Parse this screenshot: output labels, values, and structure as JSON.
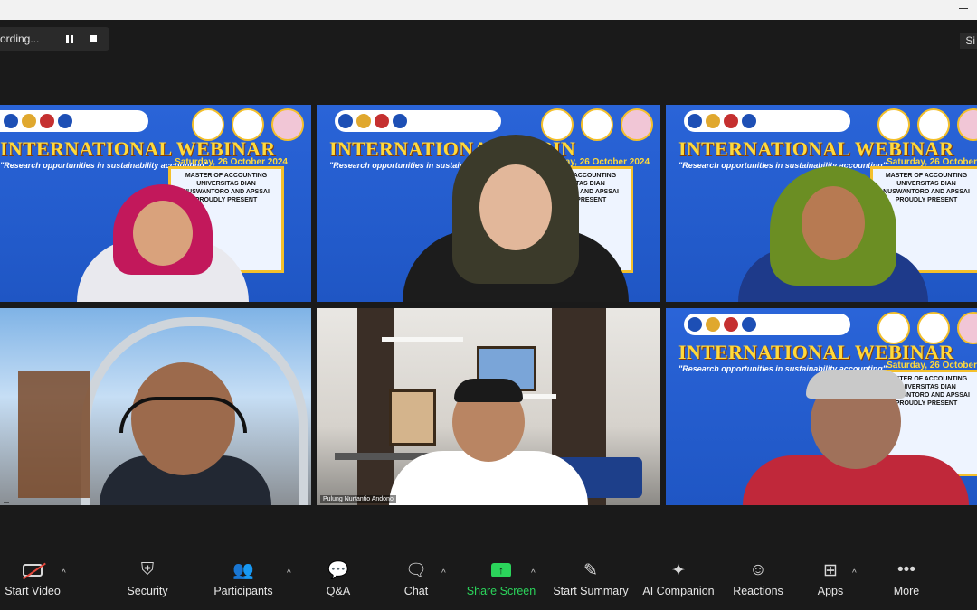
{
  "recording": {
    "label": "ording...",
    "view_label": "Si"
  },
  "tiles": [
    {
      "title": "INTERNATIONAL WEBINAR",
      "subtitle": "\"Research opportunities in sustainability accounting\"",
      "date": "Saturday, 26 October 2024",
      "box": "MASTER OF ACCOUNTING UNIVERSITAS DIAN NUSWANTORO AND APSSAI PROUDLY PRESENT"
    },
    {
      "title": "INTERNATIONAL WEBIN",
      "subtitle": "\"Research opportunities in sustainability a",
      "date": "urday, 26 October 2024",
      "box": "MASTER OF ACCOUNTING UNIVERSITAS DIAN NUSWANTORO AND APSSAI PROUDLY PRESENT"
    },
    {
      "title": "INTERNATIONAL WEBINAR",
      "subtitle": "\"Research opportunities in sustainability accounting\"",
      "date": "Saturday, 26 October",
      "box": "MASTER OF ACCOUNTING UNIVERSITAS DIAN NUSWANTORO AND APSSAI PROUDLY PRESENT"
    },
    {
      "name": ""
    },
    {
      "name": "Pulung Nurtantio Andono"
    },
    {
      "title": "INTERNATIONAL WEBINAR",
      "subtitle": "\"Research opportunities in sustainability accounting\"",
      "date": "Saturday, 26 October",
      "box": "MASTER OF ACCOUNTING UNIVERSITAS DIAN NUSWANTORO AND APSSAI PROUDLY PRESENT"
    }
  ],
  "toolbar": {
    "start_video": "Start Video",
    "security": "Security",
    "participants": "Participants",
    "qa": "Q&A",
    "chat": "Chat",
    "share_screen": "Share Screen",
    "start_summary": "Start Summary",
    "ai_companion": "AI Companion",
    "reactions": "Reactions",
    "apps": "Apps",
    "more": "More"
  },
  "icons": {
    "security": "shield-icon",
    "participants": "people-icon",
    "qa": "qa-icon",
    "chat": "chat-icon",
    "share": "share-screen-icon",
    "summary": "summary-icon",
    "ai": "sparkle-icon",
    "reactions": "smiley-icon",
    "apps": "apps-icon",
    "more": "more-icon"
  },
  "colors": {
    "accent_green": "#2bd45b",
    "webinar_blue": "#2a64d8",
    "title_yellow": "#ffd93b",
    "muted_red": "#e5483c"
  }
}
